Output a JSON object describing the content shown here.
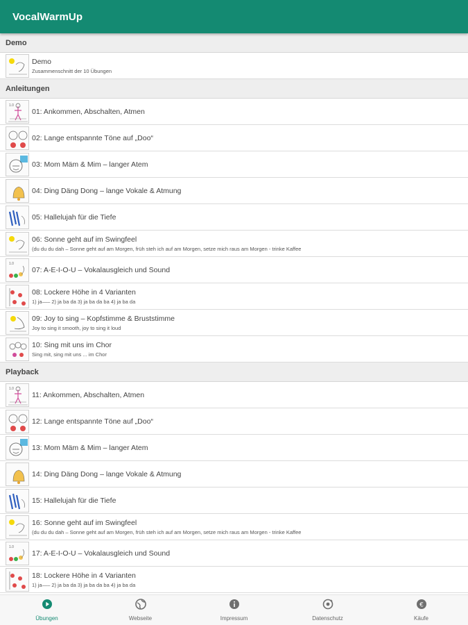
{
  "app": {
    "title": "VocalWarmUp"
  },
  "colors": {
    "primary": "#148a72",
    "section_bg": "#eeeeee",
    "divider": "#dcdcdc"
  },
  "sections": [
    {
      "title": "Demo",
      "items": [
        {
          "title": "Demo",
          "subtitle": "Zusammenschnitt der 10 Übungen",
          "icon": "sun-sketch-icon"
        }
      ]
    },
    {
      "title": "Anleitungen",
      "items": [
        {
          "title": "01: Ankommen, Abschalten, Atmen",
          "subtitle": "",
          "icon": "sketch-person-icon"
        },
        {
          "title": "02: Lange entspannte Töne auf „Doo“",
          "subtitle": "",
          "icon": "sketch-faces-icon"
        },
        {
          "title": "03: Mom Mäm & Mim – langer Atem",
          "subtitle": "",
          "icon": "sketch-face-blue-icon"
        },
        {
          "title": "04: Ding Däng Dong – lange Vokale & Atmung",
          "subtitle": "",
          "icon": "sketch-bell-icon"
        },
        {
          "title": "05: Hallelujah für die Tiefe",
          "subtitle": "",
          "icon": "sketch-blue-stripes-icon"
        },
        {
          "title": "06: Sonne geht auf im Swingfeel",
          "subtitle": "(du du du dah – Sonne geht auf am Morgen, früh steh ich auf am Morgen, setze mich raus am Morgen - trinke Kaffee",
          "icon": "sun-sketch-icon"
        },
        {
          "title": "07: A-E-I-O-U – Vokalausgleich und Sound",
          "subtitle": "",
          "icon": "sketch-dots-icon"
        },
        {
          "title": "08: Lockere Höhe in 4 Varianten",
          "subtitle": "1) ja—– 2) ja ba da 3) ja ba da ba 4) ja ba da",
          "icon": "sketch-red-figures-icon"
        },
        {
          "title": "09: Joy to sing – Kopfstimme & Bruststimme",
          "subtitle": "Joy to sing it smooth, joy to sing it loud",
          "icon": "sketch-singer-icon"
        },
        {
          "title": "10: Sing mit uns im Chor",
          "subtitle": "Sing mit, sing mit uns ... im Chor",
          "icon": "sketch-choir-icon"
        }
      ]
    },
    {
      "title": "Playback",
      "items": [
        {
          "title": "11: Ankommen, Abschalten, Atmen",
          "subtitle": "",
          "icon": "sketch-person-icon"
        },
        {
          "title": "12: Lange entspannte Töne auf „Doo“",
          "subtitle": "",
          "icon": "sketch-faces-icon"
        },
        {
          "title": "13: Mom Mäm & Mim – langer Atem",
          "subtitle": "",
          "icon": "sketch-face-blue-icon"
        },
        {
          "title": "14: Ding Däng Dong – lange Vokale & Atmung",
          "subtitle": "",
          "icon": "sketch-bell-icon"
        },
        {
          "title": "15: Hallelujah für die Tiefe",
          "subtitle": "",
          "icon": "sketch-blue-stripes-icon"
        },
        {
          "title": "16: Sonne geht auf im Swingfeel",
          "subtitle": "(du du du dah – Sonne geht auf am Morgen, früh steh ich auf am Morgen, setze mich raus am Morgen - trinke Kaffee",
          "icon": "sun-sketch-icon"
        },
        {
          "title": "17: A-E-I-O-U – Vokalausgleich und Sound",
          "subtitle": "",
          "icon": "sketch-dots-icon"
        },
        {
          "title": "18: Lockere Höhe in 4 Varianten",
          "subtitle": "1) ja—– 2) ja ba da 3) ja ba da ba 4) ja ba da",
          "icon": "sketch-red-figures-icon"
        }
      ]
    }
  ],
  "bottom_nav": [
    {
      "label": "Übungen",
      "icon": "play-circle-icon",
      "active": true
    },
    {
      "label": "Webseite",
      "icon": "globe-icon",
      "active": false
    },
    {
      "label": "Impressum",
      "icon": "info-icon",
      "active": false
    },
    {
      "label": "Datenschutz",
      "icon": "privacy-icon",
      "active": false
    },
    {
      "label": "Käufe",
      "icon": "euro-icon",
      "active": false
    }
  ]
}
